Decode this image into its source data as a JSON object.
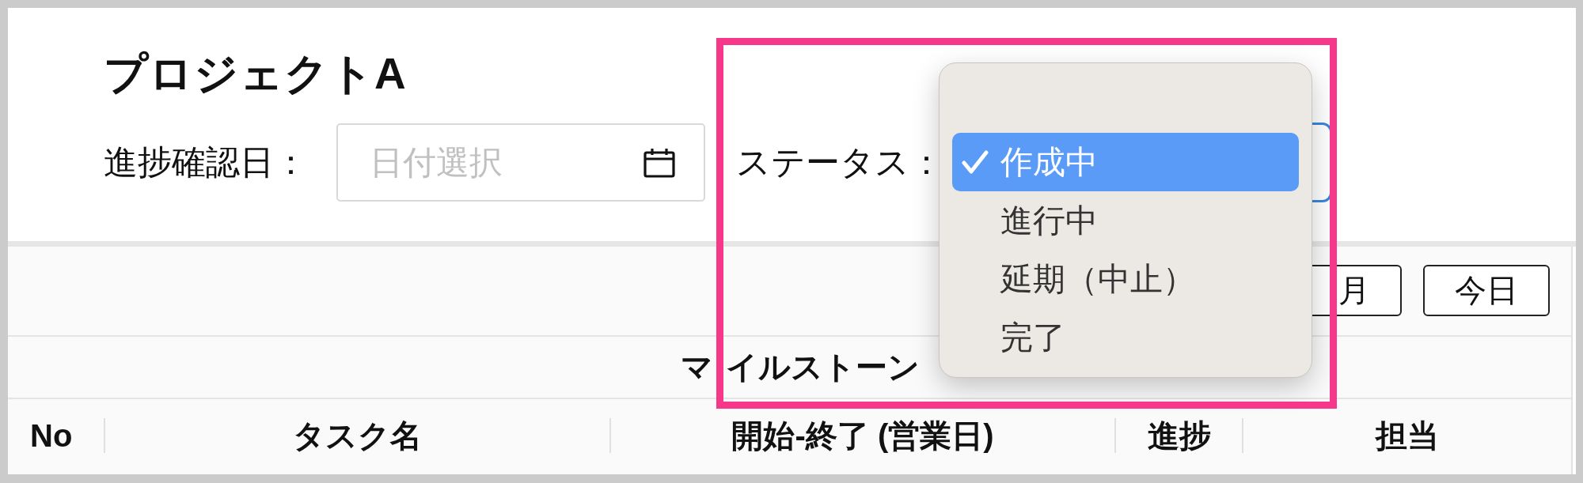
{
  "project": {
    "title": "プロジェクトA"
  },
  "filters": {
    "date": {
      "label": "進捗確認日：",
      "placeholder": "日付選択"
    },
    "status": {
      "label": "ステータス：",
      "options": [
        {
          "label": "作成中",
          "selected": true
        },
        {
          "label": "進行中",
          "selected": false
        },
        {
          "label": "延期（中止）",
          "selected": false
        },
        {
          "label": "完了",
          "selected": false
        }
      ]
    }
  },
  "toolbar": {
    "buttons": [
      "月",
      "今日"
    ]
  },
  "table": {
    "group_header": "マイルストーン",
    "columns": [
      "No",
      "タスク名",
      "開始-終了 (営業日)",
      "進捗",
      "担当"
    ]
  }
}
